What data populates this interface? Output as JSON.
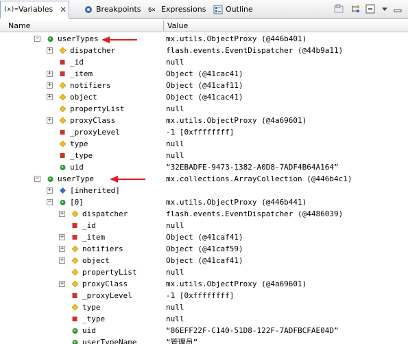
{
  "tabs": [
    {
      "label": "Variables",
      "prefix": "(x)="
    },
    {
      "label": "Breakpoints"
    },
    {
      "label": "Expressions"
    },
    {
      "label": "Outline"
    }
  ],
  "columns": {
    "name": "Name",
    "value": "Value"
  },
  "rows": [
    {
      "name": "userTypes",
      "value": "mx.utils.ObjectProxy (@446b401)",
      "expander": "−",
      "icon": "public-field-icon",
      "indent": 0
    },
    {
      "name": "dispatcher",
      "value": "flash.events.EventDispatcher (@44b9a11)",
      "expander": "+",
      "icon": "protected-field-icon",
      "indent": 1
    },
    {
      "name": "_id",
      "value": "null",
      "icon": "private-field-icon",
      "indent": 1
    },
    {
      "name": "_item",
      "value": "Object (@41cac41)",
      "expander": "+",
      "icon": "private-field-icon",
      "indent": 1
    },
    {
      "name": "notifiers",
      "value": "Object (@41caf11)",
      "expander": "+",
      "icon": "protected-field-icon",
      "indent": 1
    },
    {
      "name": "object",
      "value": "Object (@41cac41)",
      "expander": "+",
      "icon": "protected-field-icon",
      "indent": 1
    },
    {
      "name": "propertyList",
      "value": "null",
      "icon": "protected-field-icon",
      "indent": 1
    },
    {
      "name": "proxyClass",
      "value": "mx.utils.ObjectProxy (@4a69601)",
      "expander": "+",
      "icon": "protected-field-icon",
      "indent": 1
    },
    {
      "name": "_proxyLevel",
      "value": "-1 [0xffffffff]",
      "icon": "private-field-icon",
      "indent": 1
    },
    {
      "name": "type",
      "value": "null",
      "icon": "protected-field-icon",
      "indent": 1
    },
    {
      "name": "_type",
      "value": "null",
      "icon": "private-field-icon",
      "indent": 1
    },
    {
      "name": "uid",
      "value": "“32EBADFE-9473-1382-A0D8-7ADF4B64A164”",
      "icon": "public-field-icon",
      "indent": 1
    },
    {
      "name": "userType",
      "value": "mx.collections.ArrayCollection (@446b4c1)",
      "expander": "−",
      "icon": "public-field-icon",
      "indent": 0
    },
    {
      "name": "[inherited]",
      "value": "",
      "expander": "+",
      "icon": "inherited-icon",
      "indent": 1
    },
    {
      "name": "[0]",
      "value": "mx.utils.ObjectProxy (@446b441)",
      "expander": "−",
      "icon": "public-field-icon",
      "indent": 1
    },
    {
      "name": "dispatcher",
      "value": "flash.events.EventDispatcher (@4486039)",
      "expander": "+",
      "icon": "protected-field-icon",
      "indent": 2
    },
    {
      "name": "_id",
      "value": "null",
      "icon": "private-field-icon",
      "indent": 2
    },
    {
      "name": "_item",
      "value": "Object (@41caf41)",
      "expander": "+",
      "icon": "private-field-icon",
      "indent": 2
    },
    {
      "name": "notifiers",
      "value": "Object (@41caf59)",
      "expander": "+",
      "icon": "protected-field-icon",
      "indent": 2
    },
    {
      "name": "object",
      "value": "Object (@41caf41)",
      "expander": "+",
      "icon": "protected-field-icon",
      "indent": 2
    },
    {
      "name": "propertyList",
      "value": "null",
      "icon": "protected-field-icon",
      "indent": 2
    },
    {
      "name": "proxyClass",
      "value": "mx.utils.ObjectProxy (@4a69601)",
      "expander": "+",
      "icon": "protected-field-icon",
      "indent": 2
    },
    {
      "name": "_proxyLevel",
      "value": "-1 [0xffffffff]",
      "icon": "private-field-icon",
      "indent": 2
    },
    {
      "name": "type",
      "value": "null",
      "icon": "protected-field-icon",
      "indent": 2
    },
    {
      "name": "_type",
      "value": "null",
      "icon": "private-field-icon",
      "indent": 2
    },
    {
      "name": "uid",
      "value": "“86EFF22F-C140-51D8-122F-7ADFBCFAE04D”",
      "icon": "public-field-icon",
      "indent": 2
    },
    {
      "name": "userTypeName",
      "value": "“管理员”",
      "icon": "public-field-icon",
      "indent": 2
    }
  ],
  "colors": {
    "arrow": "#e02020",
    "public": "#2e9b2e",
    "protected": "#f0c020",
    "private": "#cc3333",
    "inherited": "#3070c0"
  }
}
